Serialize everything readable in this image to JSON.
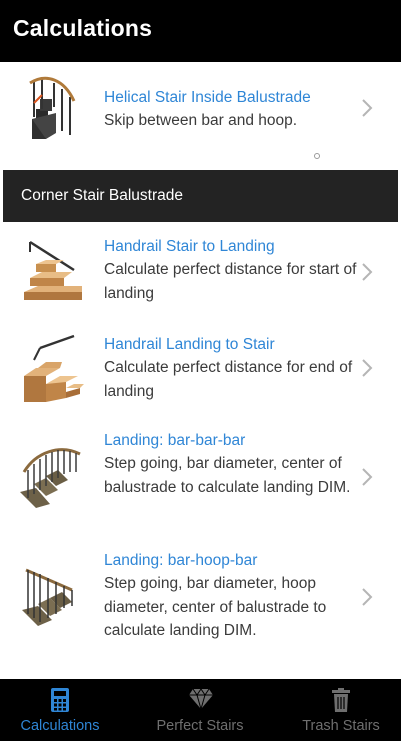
{
  "header": {
    "title": "Calculations"
  },
  "top_item": {
    "title": "Helical Stair Inside Balustrade",
    "description": "Skip between bar and hoop.",
    "icon": "helical-stair-thumbnail"
  },
  "section": {
    "title": "Corner Stair Balustrade"
  },
  "items": [
    {
      "title": "Handrail Stair to Landing",
      "description": "Calculate perfect distance for start of landing",
      "icon": "stair-to-landing-thumbnail"
    },
    {
      "title": "Handrail Landing to Stair",
      "description": "Calculate perfect distance for end of landing",
      "icon": "landing-to-stair-thumbnail"
    },
    {
      "title": "Landing: bar-bar-bar",
      "description": "Step going, bar diameter, center of balustrade to calculate landing DIM.",
      "icon": "bar-bar-bar-thumbnail"
    },
    {
      "title": "Landing: bar-hoop-bar",
      "description": "Step going, bar diameter, hoop diameter, center of balustrade to calculate landing DIM.",
      "icon": "bar-hoop-bar-thumbnail"
    }
  ],
  "tabs": [
    {
      "label": "Calculations",
      "icon": "calculator-icon",
      "active": true
    },
    {
      "label": "Perfect Stairs",
      "icon": "diamond-icon",
      "active": false
    },
    {
      "label": "Trash Stairs",
      "icon": "trash-icon",
      "active": false
    }
  ],
  "colors": {
    "accent": "#2f86d6",
    "header_bg": "#000000",
    "section_bg": "#232323",
    "tab_inactive": "#6f6f6f"
  }
}
